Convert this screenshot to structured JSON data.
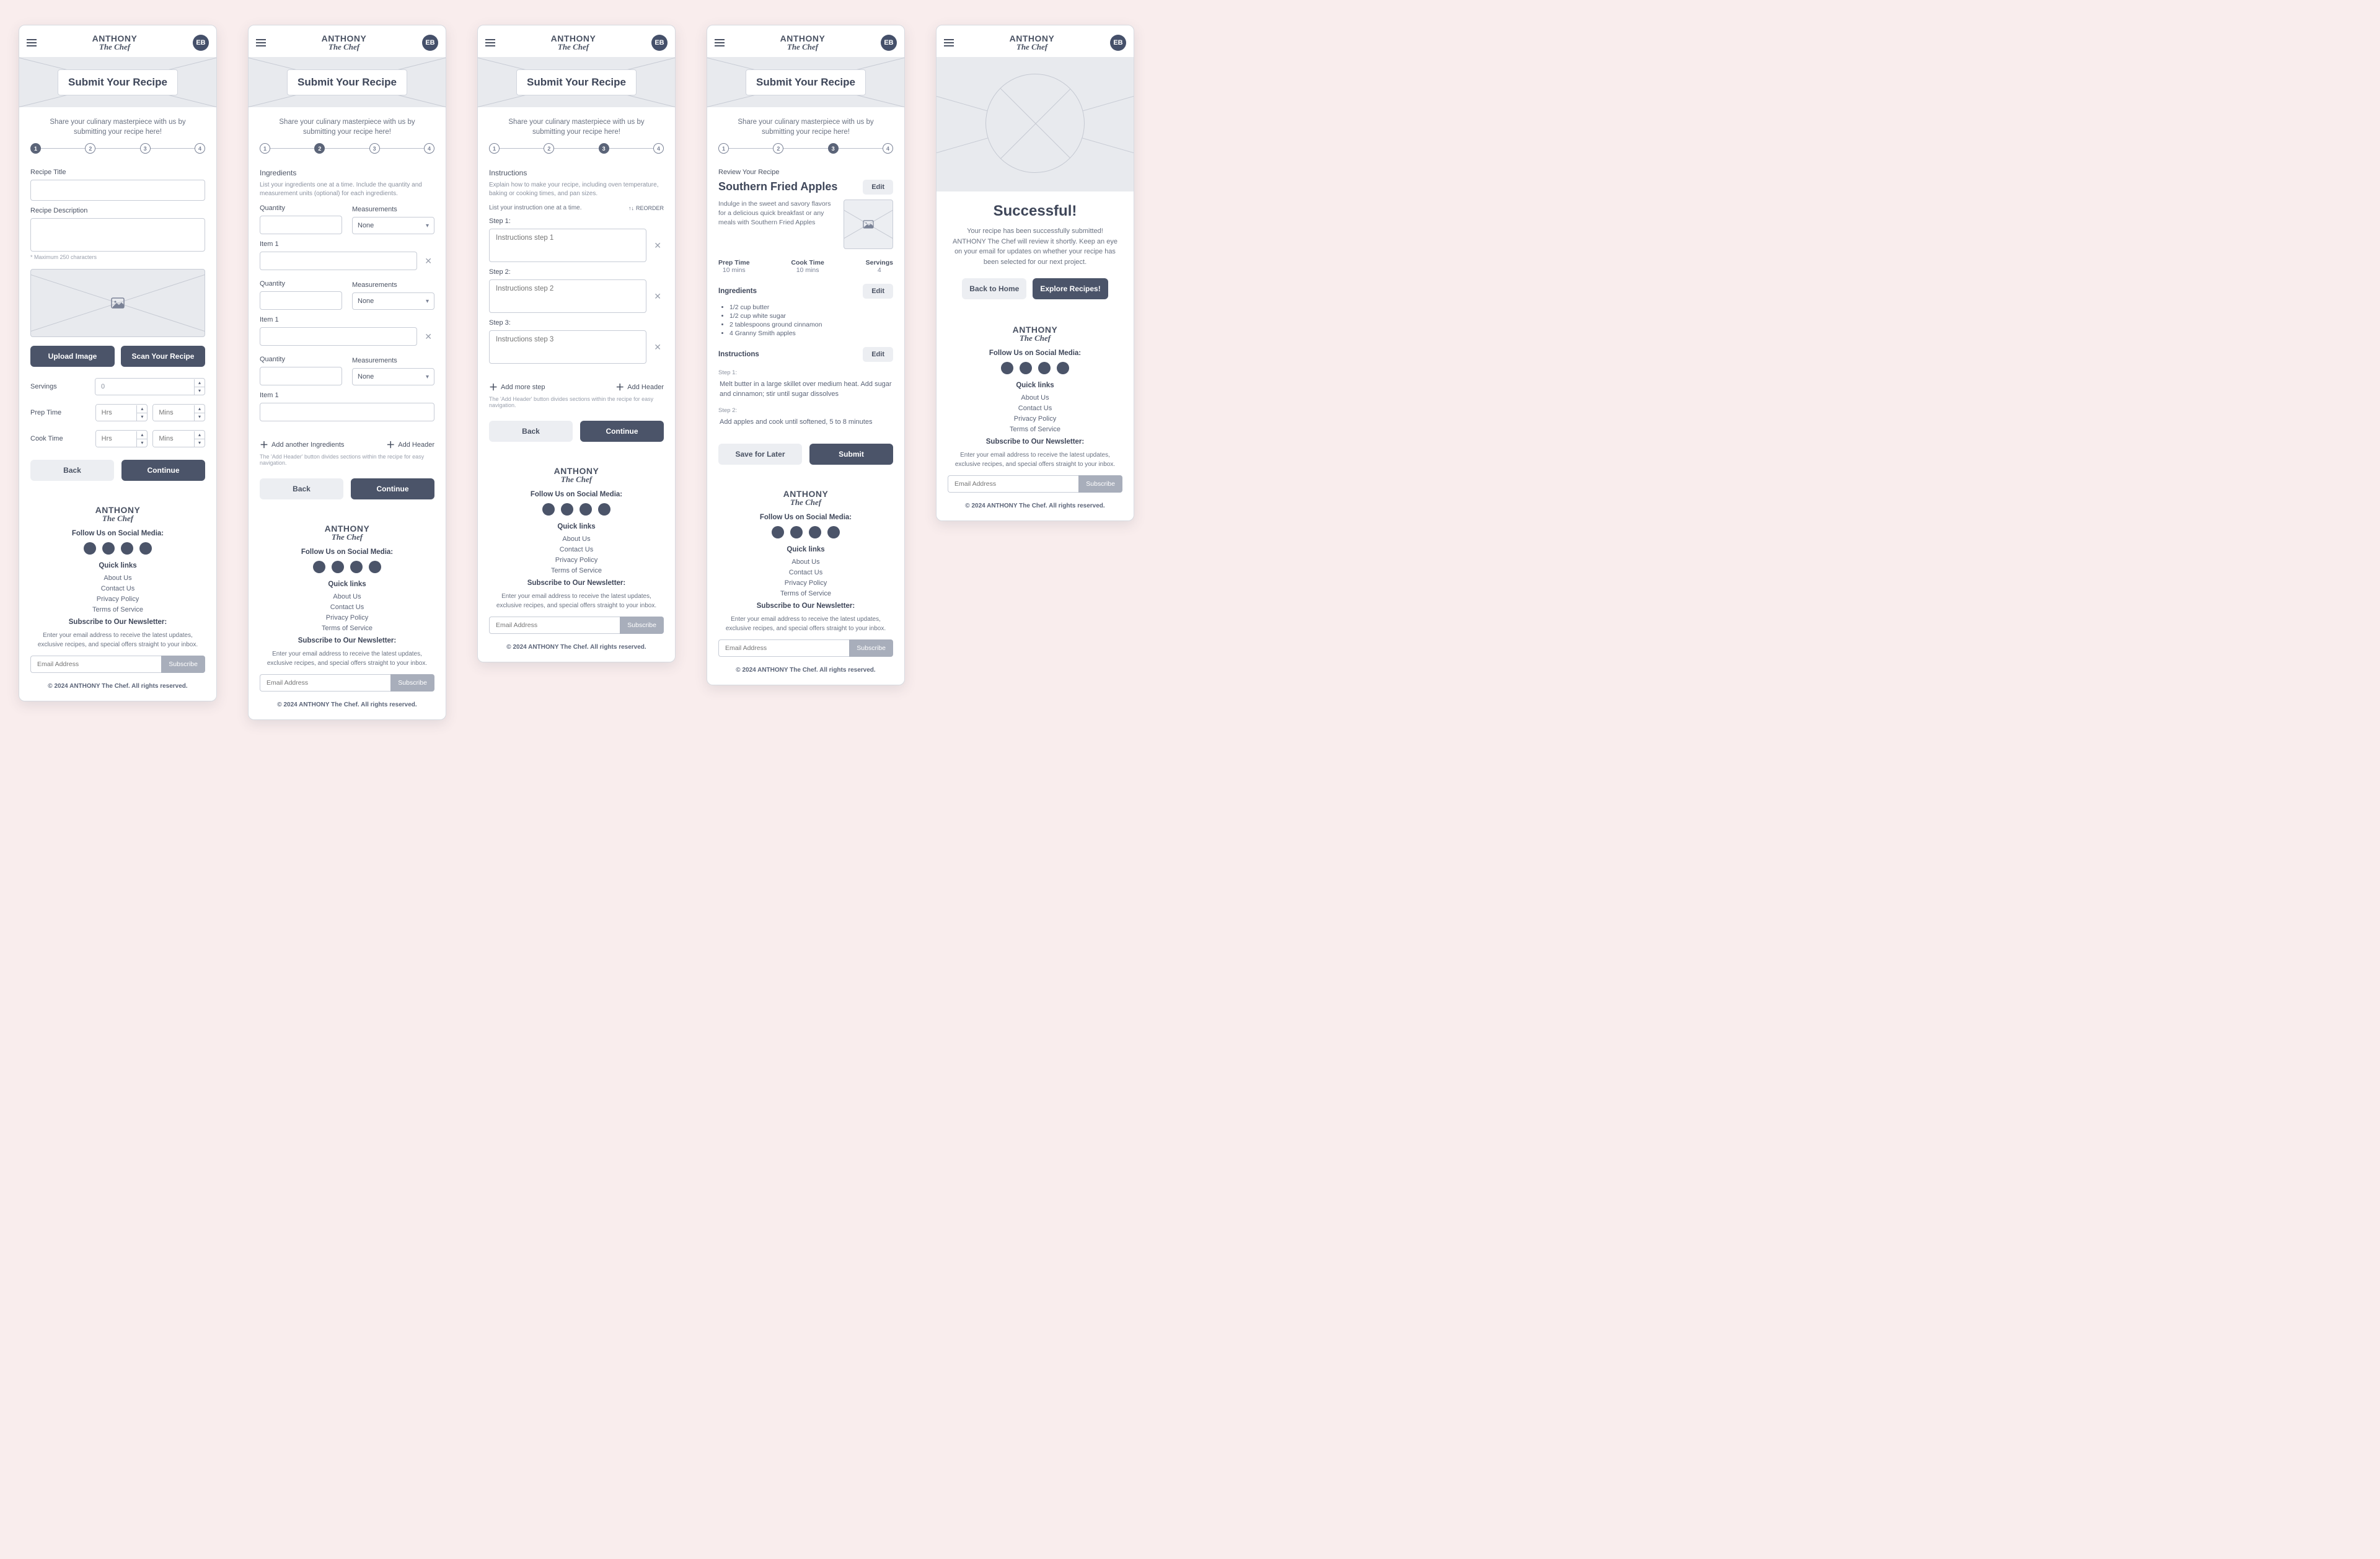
{
  "brand": {
    "line1": "ANTHONY",
    "line2": "The Chef"
  },
  "avatar": "EB",
  "page_title": "Submit Your Recipe",
  "intro": "Share your culinary masterpiece with us by submitting your recipe here!",
  "steps": [
    "1",
    "2",
    "3",
    "4"
  ],
  "screen1": {
    "title_label": "Recipe Title",
    "desc_label": "Recipe Description",
    "desc_hint": "* Maximum 250 characters",
    "upload_btn": "Upload Image",
    "scan_btn": "Scan Your Recipe",
    "servings_label": "Servings",
    "servings_value": "0",
    "prep_label": "Prep Time",
    "cook_label": "Cook Time",
    "hrs": "Hrs",
    "mins": "Mins",
    "back": "Back",
    "continue": "Continue"
  },
  "screen2": {
    "heading": "Ingredients",
    "sub": "List your ingredients one at a time. Include the quantity and measurement units (optional) for each ingredients.",
    "qty": "Quantity",
    "meas": "Measurements",
    "meas_val": "None",
    "item": "Item 1",
    "add_ing": "Add another Ingredients",
    "add_header": "Add Header",
    "add_hint": "The 'Add Header' button divides sections within the recipe for easy navigation.",
    "back": "Back",
    "continue": "Continue"
  },
  "screen3": {
    "heading": "Instructions",
    "sub": "Explain how to make your recipe, including oven temperature, baking or cooking times, and pan sizes.",
    "listone": "List your instruction one at a time.",
    "reorder": "REORDER",
    "step1_l": "Step 1:",
    "step1_ph": "Instructions step 1",
    "step2_l": "Step 2:",
    "step2_ph": "Instructions step 2",
    "step3_l": "Step 3:",
    "step3_ph": "Instructions step 3",
    "add_step": "Add more step",
    "add_header": "Add Header",
    "add_hint": "The 'Add Header' button divides sections within the recipe for easy navigation.",
    "back": "Back",
    "continue": "Continue"
  },
  "screen4": {
    "review_label": "Review Your Recipe",
    "recipe_title": "Southern Fried Apples",
    "edit": "Edit",
    "desc": "Indulge in the sweet and savory flavors for a delicious quick breakfast or any meals with Southern Fried Apples",
    "prep_l": "Prep Time",
    "prep_v": "10 mins",
    "cook_l": "Cook Time",
    "cook_v": "10 mins",
    "serv_l": "Servings",
    "serv_v": "4",
    "ing_h": "Ingredients",
    "ingredients": [
      "1/2 cup butter",
      "1/2 cup white sugar",
      "2 tablespoons ground cinnamon",
      "4 Granny Smith apples"
    ],
    "inst_h": "Instructions",
    "s1_l": "Step 1:",
    "s1": "Melt butter in a large skillet over medium heat. Add sugar and cinnamon; stir until sugar dissolves",
    "s2_l": "Step 2:",
    "s2": "Add apples and cook until softened, 5 to 8 minutes",
    "save": "Save for Later",
    "submit": "Submit"
  },
  "screen5": {
    "title": "Successful!",
    "msg": "Your recipe has been successfully submitted! ANTHONY The Chef will review it shortly. Keep an eye on your email for updates on whether your recipe has been selected for our next project.",
    "back_home": "Back to Home",
    "explore": "Explore Recipes!"
  },
  "footer": {
    "follow": "Follow Us on Social Media:",
    "quick": "Quick links",
    "links": [
      "About Us",
      "Contact Us",
      "Privacy Policy",
      "Terms of Service"
    ],
    "news_h": "Subscribe to Our Newsletter:",
    "news": "Enter your email address to receive the latest updates, exclusive recipes, and special offers straight to your inbox.",
    "email_ph": "Email Address",
    "subscribe": "Subscribe",
    "copy": "© 2024 ANTHONY The Chef. All rights reserved."
  }
}
